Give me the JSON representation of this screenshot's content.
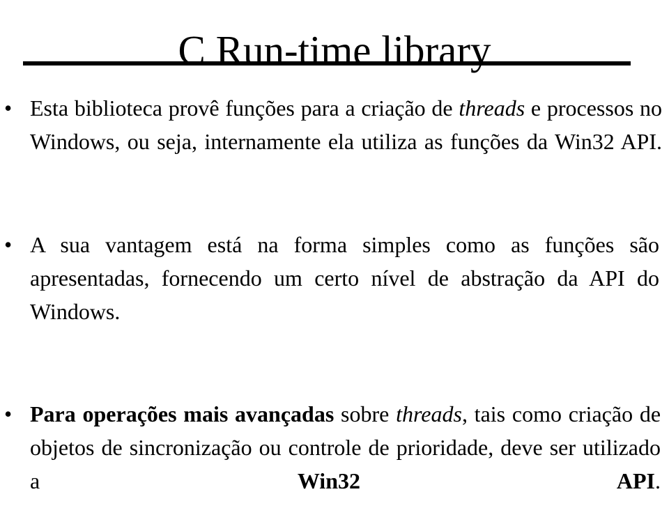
{
  "slide": {
    "title": "C Run-time library",
    "bullet_marker": "•",
    "bullets": [
      {
        "id": "bullet-1",
        "segments": [
          {
            "text": "Esta biblioteca provê funções para a criação de ",
            "style": "regular"
          },
          {
            "text": "threads",
            "style": "italic"
          },
          {
            "text": " e processos no Windows, ou seja, internamente ela utiliza as funções da Win32 API.",
            "style": "regular"
          }
        ],
        "plain_text": "Esta biblioteca provê funções para a criação de threads e processos no Windows, ou seja, internamente ela utiliza as funções da Win32 API."
      },
      {
        "id": "bullet-2",
        "segments": [
          {
            "text": "A sua vantagem está na forma simples como as funções são apresentadas, fornecendo um certo nível de abstração da API do Windows.",
            "style": "regular"
          }
        ],
        "plain_text": "A sua vantagem está na forma simples como as funções são apresentadas, fornecendo um certo nível de abstração da API do Windows."
      },
      {
        "id": "bullet-3",
        "segments": [
          {
            "text": "Para operações mais avançadas",
            "style": "bold"
          },
          {
            "text": " sobre ",
            "style": "regular"
          },
          {
            "text": "threads",
            "style": "italic"
          },
          {
            "text": ", tais como criação de objetos de sincronização ou controle de prioridade, deve ser utilizado a ",
            "style": "regular"
          },
          {
            "text": "Win32 API",
            "style": "bold"
          },
          {
            "text": ".",
            "style": "regular"
          }
        ],
        "plain_text": "Para operações mais avançadas sobre threads, tais como criação de objetos de sincronização ou controle de prioridade, deve ser utilizado a Win32 API."
      }
    ]
  },
  "colors": {
    "background": "#ffffff",
    "text": "#000000",
    "rule": "#000000"
  }
}
